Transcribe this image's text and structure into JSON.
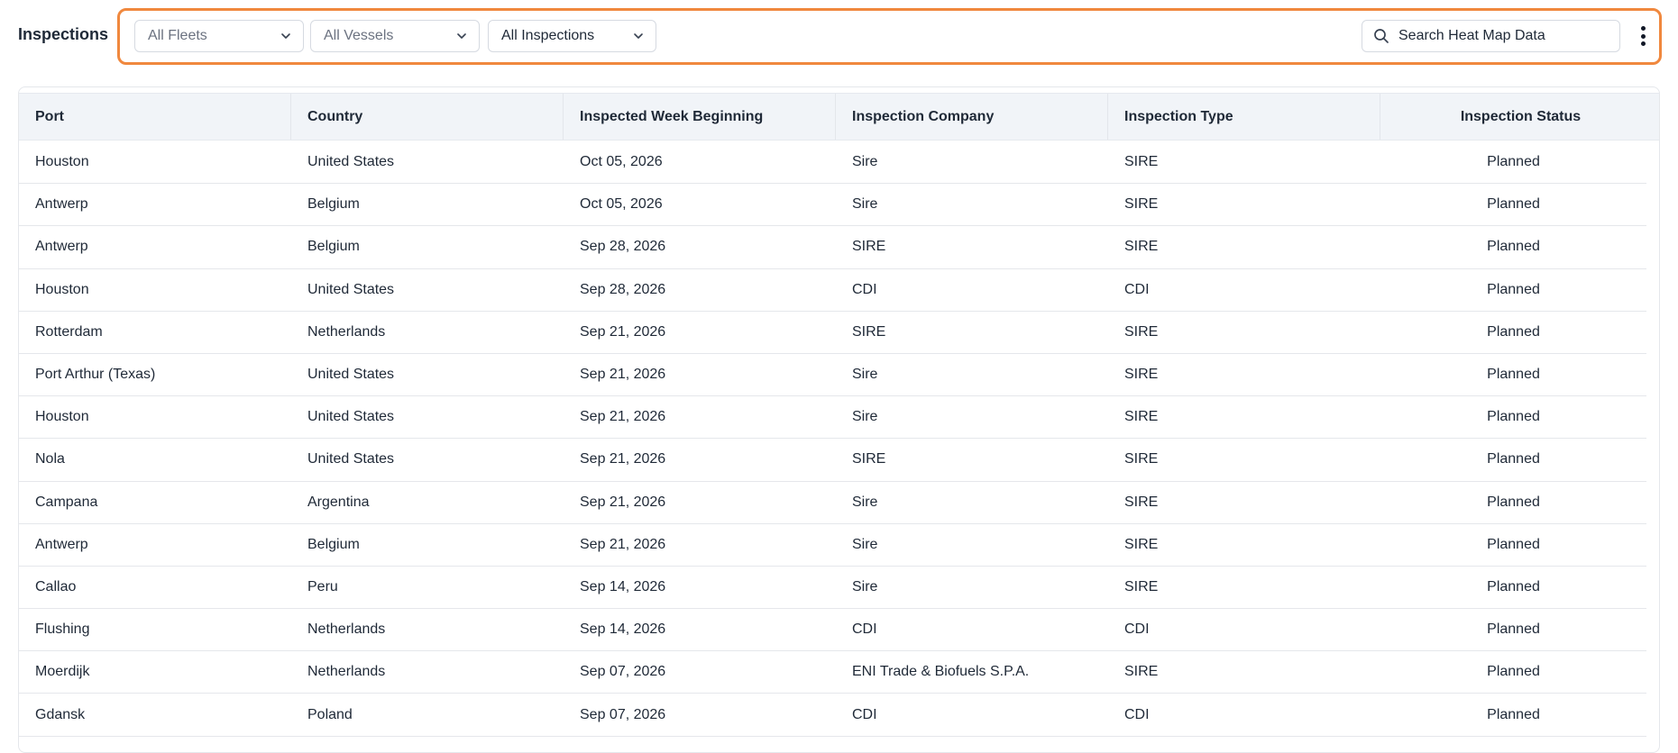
{
  "header": {
    "title": "Inspections"
  },
  "filters": {
    "fleets": "All Fleets",
    "vessels": "All Vessels",
    "inspections": "All Inspections"
  },
  "search": {
    "placeholder": "Search Heat Map Data"
  },
  "table": {
    "columns": [
      "Port",
      "Country",
      "Inspected Week Beginning",
      "Inspection Company",
      "Inspection Type",
      "Inspection Status"
    ],
    "rows": [
      [
        "Houston",
        "United States",
        "Oct 05, 2026",
        "Sire",
        "SIRE",
        "Planned"
      ],
      [
        "Antwerp",
        "Belgium",
        "Oct 05, 2026",
        "Sire",
        "SIRE",
        "Planned"
      ],
      [
        "Antwerp",
        "Belgium",
        "Sep 28, 2026",
        "SIRE",
        "SIRE",
        "Planned"
      ],
      [
        "Houston",
        "United States",
        "Sep 28, 2026",
        "CDI",
        "CDI",
        "Planned"
      ],
      [
        "Rotterdam",
        "Netherlands",
        "Sep 21, 2026",
        "SIRE",
        "SIRE",
        "Planned"
      ],
      [
        "Port Arthur (Texas)",
        "United States",
        "Sep 21, 2026",
        "Sire",
        "SIRE",
        "Planned"
      ],
      [
        "Houston",
        "United States",
        "Sep 21, 2026",
        "Sire",
        "SIRE",
        "Planned"
      ],
      [
        "Nola",
        "United States",
        "Sep 21, 2026",
        "SIRE",
        "SIRE",
        "Planned"
      ],
      [
        "Campana",
        "Argentina",
        "Sep 21, 2026",
        "Sire",
        "SIRE",
        "Planned"
      ],
      [
        "Antwerp",
        "Belgium",
        "Sep 21, 2026",
        "Sire",
        "SIRE",
        "Planned"
      ],
      [
        "Callao",
        "Peru",
        "Sep 14, 2026",
        "Sire",
        "SIRE",
        "Planned"
      ],
      [
        "Flushing",
        "Netherlands",
        "Sep 14, 2026",
        "CDI",
        "CDI",
        "Planned"
      ],
      [
        "Moerdijk",
        "Netherlands",
        "Sep 07, 2026",
        "ENI Trade & Biofuels S.P.A.",
        "SIRE",
        "Planned"
      ],
      [
        "Gdansk",
        "Poland",
        "Sep 07, 2026",
        "CDI",
        "CDI",
        "Planned"
      ]
    ]
  },
  "icons": {
    "search": "search-icon",
    "dropdown": "chevron-down-icon",
    "menu": "kebab-menu-icon"
  },
  "colors": {
    "filter_frame": "#f0883e",
    "header_bg": "#f1f4f8",
    "text": "#1f2937"
  }
}
